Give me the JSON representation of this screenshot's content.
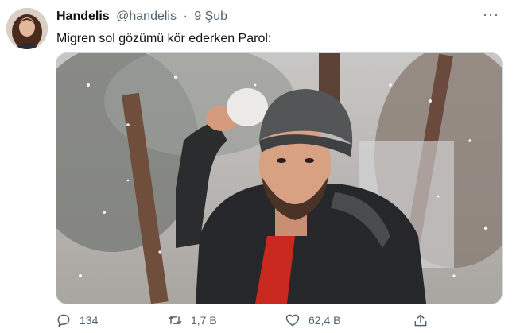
{
  "tweet": {
    "display_name": "Handelis",
    "handle": "@handelis",
    "separator": "·",
    "date": "9 Şub",
    "text": "Migren sol gözümü kör ederken Parol:",
    "more_icon": "more-dots-icon"
  },
  "actions": {
    "replies": "134",
    "retweets": "1,7 B",
    "likes": "62,4 B",
    "icons": [
      "reply-icon",
      "retweet-icon",
      "like-icon",
      "share-icon"
    ]
  },
  "colors": {
    "text_primary": "#0f1419",
    "text_secondary": "#536471",
    "border": "#cfd9de"
  }
}
